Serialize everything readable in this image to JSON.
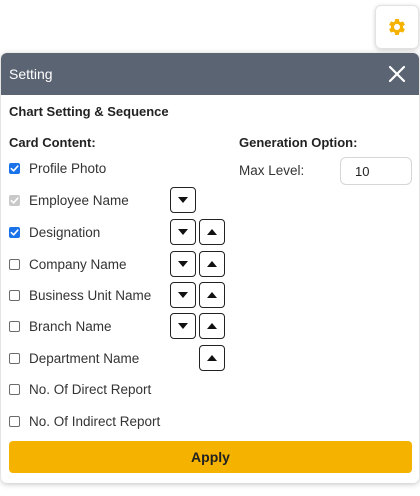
{
  "settings_button": {
    "icon": "gear-icon",
    "color": "#f5b300"
  },
  "panel": {
    "title": "Setting",
    "close_icon": "close-icon",
    "section_title": "Chart Setting & Sequence",
    "card_content": {
      "title": "Card Content:",
      "items": [
        {
          "label": "Profile Photo",
          "state": "checked",
          "move_down": false,
          "move_up": false
        },
        {
          "label": "Employee Name",
          "state": "checked-disabled",
          "move_down": true,
          "move_up": false
        },
        {
          "label": "Designation",
          "state": "checked",
          "move_down": true,
          "move_up": true
        },
        {
          "label": "Company Name",
          "state": "unchecked",
          "move_down": true,
          "move_up": true
        },
        {
          "label": "Business Unit Name",
          "state": "unchecked",
          "move_down": true,
          "move_up": true
        },
        {
          "label": "Branch Name",
          "state": "unchecked",
          "move_down": true,
          "move_up": true
        },
        {
          "label": "Department Name",
          "state": "unchecked",
          "move_down": false,
          "move_up": true
        },
        {
          "label": "No. Of Direct Report",
          "state": "unchecked",
          "move_down": false,
          "move_up": false
        },
        {
          "label": "No. Of Indirect Report",
          "state": "unchecked",
          "move_down": false,
          "move_up": false
        }
      ]
    },
    "generation_option": {
      "title": "Generation Option:",
      "max_level_label": "Max Level:",
      "max_level_value": "10"
    },
    "apply_label": "Apply"
  },
  "colors": {
    "header_bg": "#5b6473",
    "accent": "#f5b300",
    "checkbox_checked": "#1a73e8"
  }
}
